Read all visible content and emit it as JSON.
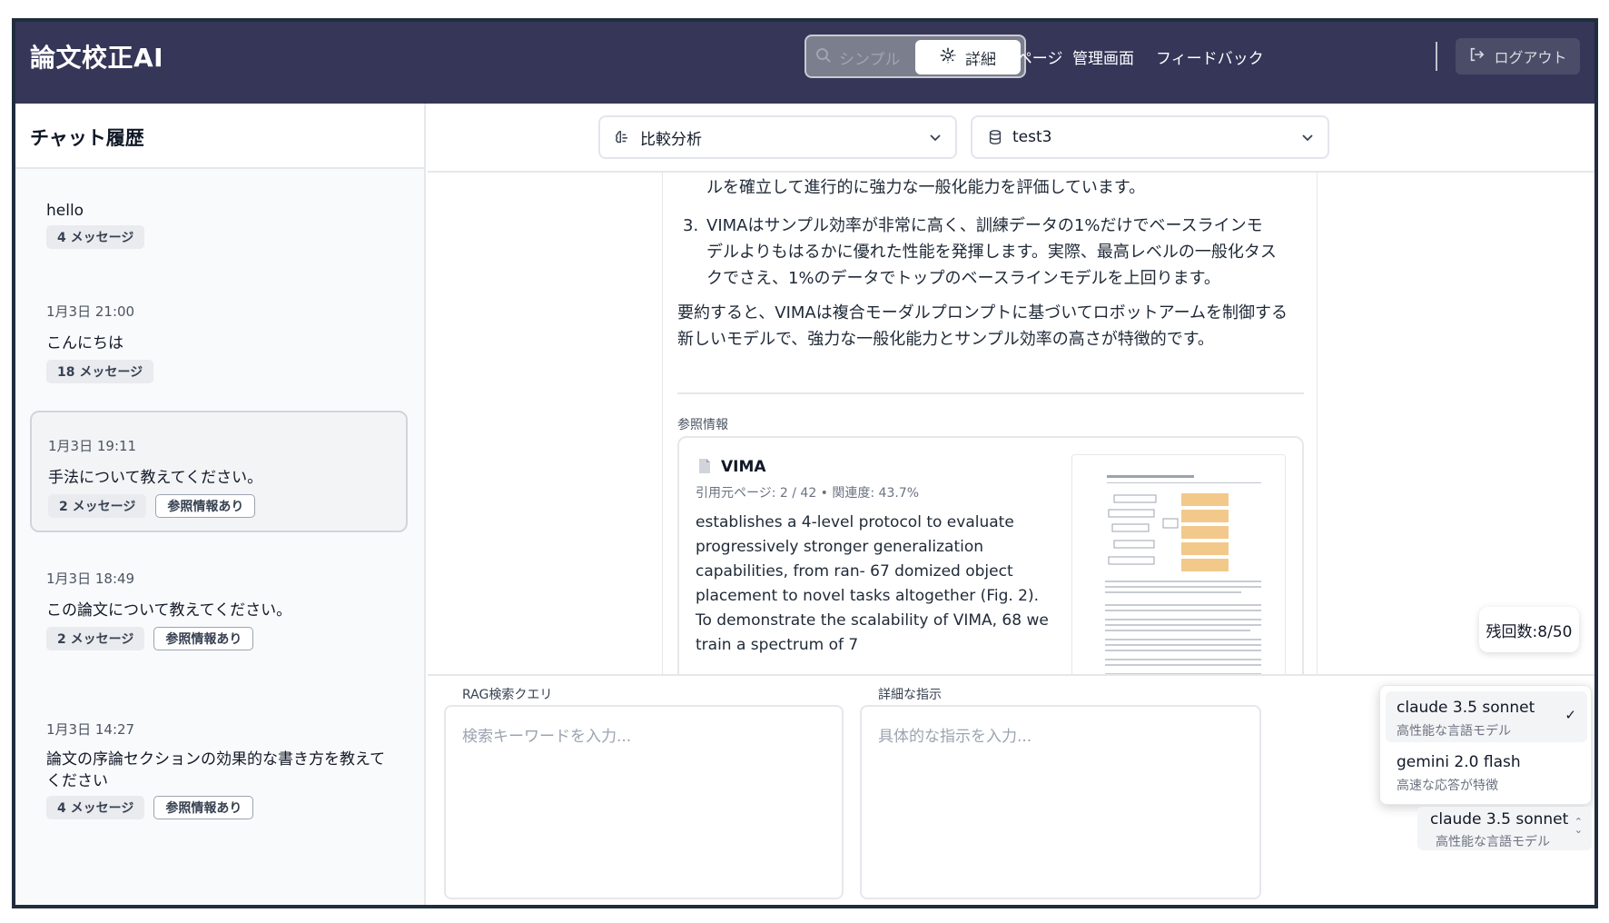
{
  "header": {
    "app_title": "論文校正AI",
    "mode_simple": "シンプル",
    "mode_detail": "詳細",
    "nav": [
      "ランディングページ",
      "管理画面",
      "フィードバック"
    ],
    "logout": "ログアウト"
  },
  "sidebar": {
    "title": "チャット履歴",
    "items": [
      {
        "date": "",
        "title": "hello",
        "badges": [
          "4 メッセージ"
        ]
      },
      {
        "date": "1月3日 21:00",
        "title": "こんにちは",
        "badges": [
          "18 メッセージ"
        ]
      },
      {
        "date": "1月3日 19:11",
        "title": "手法について教えてください。",
        "badges": [
          "2 メッセージ",
          "参照情報あり"
        ]
      },
      {
        "date": "1月3日 18:49",
        "title": "この論文について教えてください。",
        "badges": [
          "2 メッセージ",
          "参照情報あり"
        ]
      },
      {
        "date": "1月3日 14:27",
        "title": "論文の序論セクションの効果的な書き方を教えてください",
        "badges": [
          "4 メッセージ",
          "参照情報あり"
        ]
      }
    ]
  },
  "topbar": {
    "analysis_select": "比較分析",
    "dataset_select": "test3"
  },
  "message": {
    "item2_tail": "ルを確立して進行的に強力な一般化能力を評価しています。",
    "item3_num": "3.",
    "item3_text": "VIMAはサンプル効率が非常に高く、訓練データの1%だけでベースラインモデルよりもはるかに優れた性能を発揮します。実際、最高レベルの一般化タスクでさえ、1%のデータでトップのベースラインモデルを上回ります。",
    "summary": "要約すると、VIMAは複合モーダルプロンプトに基づいてロボットアームを制御する新しいモデルで、強力な一般化能力とサンプル効率の高さが特徴的です。"
  },
  "reference": {
    "label": "参照情報",
    "name": "VIMA",
    "meta": "引用元ページ: 2 / 42 • 関連度: 43.7%",
    "excerpt": "establishes a 4-level protocol to evaluate progressively stronger generalization capabilities, from ran- 67 domized object placement to novel tasks altogether (Fig. 2). To demonstrate the scalability of VIMA, 68 we train a spectrum of 7"
  },
  "remaining": "残回数:8/50",
  "inputs": {
    "rag_label": "RAG検索クエリ",
    "rag_placeholder": "検索キーワードを入力...",
    "detail_label": "詳細な指示",
    "detail_placeholder": "具体的な指示を入力..."
  },
  "models": {
    "options": [
      {
        "name": "claude 3.5 sonnet",
        "desc": "高性能な言語モデル",
        "selected": true
      },
      {
        "name": "gemini 2.0 flash",
        "desc": "高速な応答が特徴",
        "selected": false
      }
    ],
    "current": {
      "name": "claude 3.5 sonnet",
      "desc": "高性能な言語モデル"
    },
    "check_mark": "✓"
  }
}
